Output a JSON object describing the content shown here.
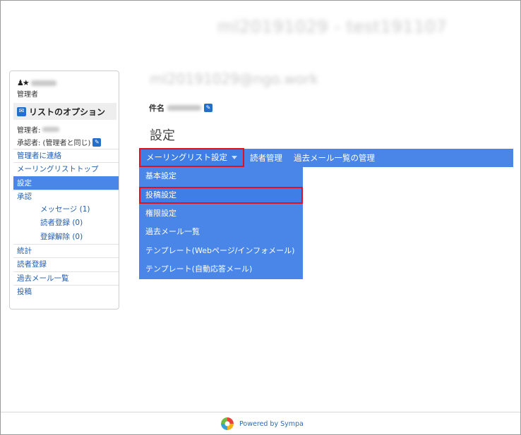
{
  "header": {
    "list_title": "ml20191029 - test191107"
  },
  "sidebar": {
    "user_name": "",
    "role": "管理者",
    "options_title": "リストのオプション",
    "owner_label": "管理者:",
    "moderator_label": "承認者: (管理者と同じ)",
    "contact_owner": "管理者に連絡",
    "nav": [
      {
        "label": "メーリングリストトップ"
      },
      {
        "label": "設定"
      },
      {
        "label": "承認"
      },
      {
        "label": "メッセージ (1)"
      },
      {
        "label": "読者登録 (0)"
      },
      {
        "label": "登録解除 (0)"
      },
      {
        "label": "統計"
      },
      {
        "label": "読者登録"
      },
      {
        "label": "過去メール一覧"
      },
      {
        "label": "投稿"
      }
    ]
  },
  "main": {
    "list_email": "ml20191029@ngo.work",
    "subject_label": "件名",
    "heading": "設定",
    "menubar": {
      "dropdown_label": "メーリングリスト設定",
      "subscribers": "読者管理",
      "archives_admin": "過去メール一覧の管理"
    },
    "dropdown": [
      {
        "label": "基本設定"
      },
      {
        "label": "投稿設定"
      },
      {
        "label": "権限設定"
      },
      {
        "label": "過去メール一覧"
      },
      {
        "label": "テンプレート(Webページ/インフォメール)"
      },
      {
        "label": "テンプレート(自動応答メール)"
      }
    ]
  },
  "footer": {
    "powered_by": "Powered by Sympa"
  },
  "colors": {
    "accent": "#4a86e8",
    "highlight_border": "#e0101e",
    "link": "#1e5db0"
  }
}
